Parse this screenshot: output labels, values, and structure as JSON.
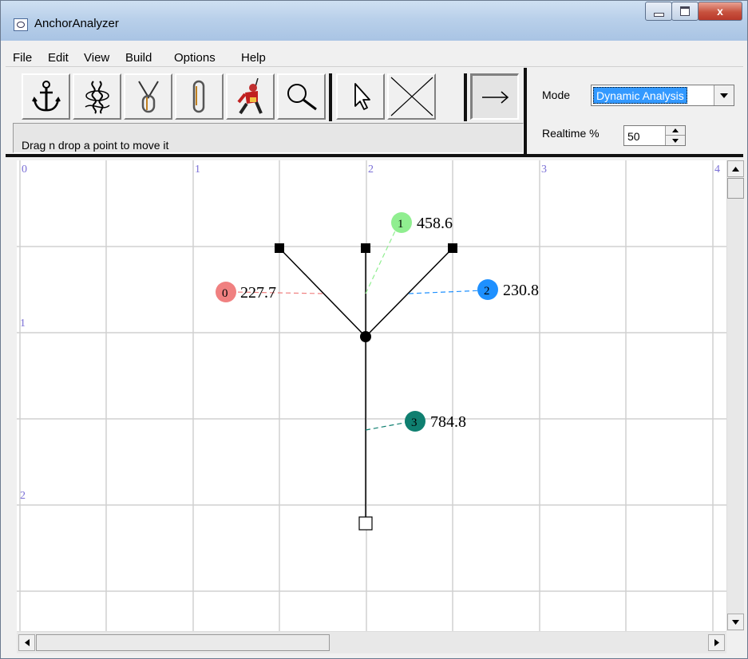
{
  "window": {
    "title": "AnchorAnalyzer",
    "controls": {
      "minimize": "minimize",
      "maximize": "maximize",
      "close": "x"
    }
  },
  "menu": [
    "File",
    "Edit",
    "View",
    "Build",
    "Options",
    "Help"
  ],
  "toolbar": {
    "tools": [
      {
        "name": "anchor-tool",
        "icon": "anchor-icon"
      },
      {
        "name": "rope-tool",
        "icon": "rope-bundle-icon"
      },
      {
        "name": "sling-tool",
        "icon": "sling-icon"
      },
      {
        "name": "carabiner-tool",
        "icon": "carabiner-icon"
      },
      {
        "name": "climber-tool",
        "icon": "climber-icon"
      },
      {
        "name": "zoom-tool",
        "icon": "magnifier-icon"
      }
    ],
    "modes": [
      {
        "name": "select-tool",
        "icon": "cursor-arrow-icon"
      },
      {
        "name": "delete-tool",
        "icon": "cross-icon"
      },
      {
        "name": "direction-tool",
        "icon": "right-arrow-icon"
      }
    ],
    "status_text": "Drag n drop a point to move it"
  },
  "controls": {
    "mode_label": "Mode",
    "mode_value": "Dynamic Analysis",
    "realtime_label": "Realtime %",
    "realtime_value": "50"
  },
  "canvas": {
    "x_axis_labels": [
      "0",
      "1",
      "2",
      "3",
      "4"
    ],
    "y_axis_labels": [
      "1",
      "2"
    ],
    "forces": [
      {
        "id": "0",
        "value": "227.7",
        "color": "#f08080"
      },
      {
        "id": "1",
        "value": "458.6",
        "color": "#90ee90"
      },
      {
        "id": "2",
        "value": "230.8",
        "color": "#1e90ff"
      },
      {
        "id": "3",
        "value": "784.8",
        "color": "#0f7f70"
      }
    ]
  },
  "colors": {
    "grid": "#d0d0d0",
    "axis_label": "#7a6fd6",
    "selection": "#3399ff"
  }
}
